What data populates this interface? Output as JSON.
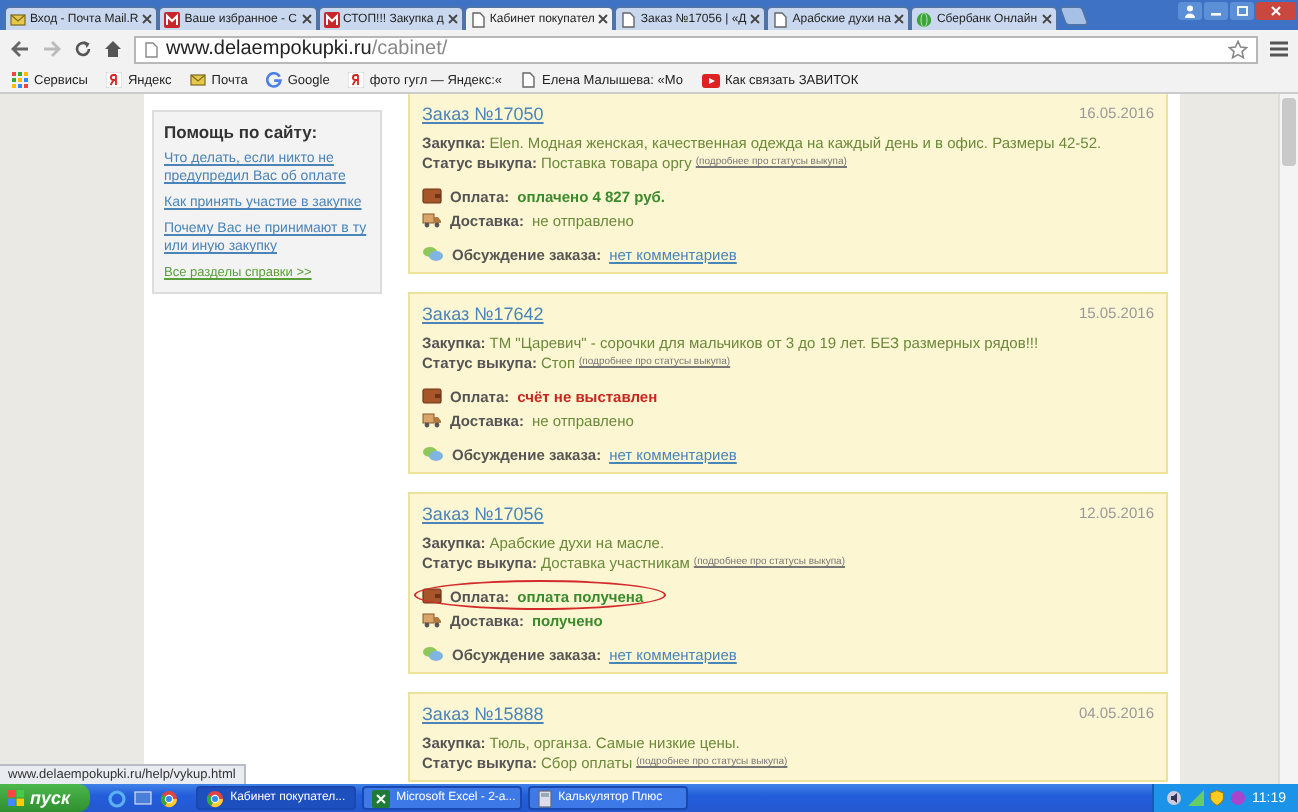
{
  "browser": {
    "tabs": [
      {
        "label": "Вход - Почта Mail.R",
        "selected": false
      },
      {
        "label": "Ваше избранное - С",
        "selected": false
      },
      {
        "label": "СТОП!!! Закупка д",
        "selected": false
      },
      {
        "label": "Кабинет покупател",
        "selected": true
      },
      {
        "label": "Заказ №17056 | «Д",
        "selected": false
      },
      {
        "label": "Арабские духи на",
        "selected": false
      },
      {
        "label": "Сбербанк Онлайн",
        "selected": false
      }
    ],
    "address": {
      "host": "www.delaempokupki.ru",
      "path": "/cabinet/"
    },
    "bookmarks": [
      {
        "label": "Сервисы"
      },
      {
        "label": "Яндекс"
      },
      {
        "label": "Почта"
      },
      {
        "label": "Google"
      },
      {
        "label": "фото гугл — Яндекс:«"
      },
      {
        "label": "Елена Малышева: «Мо"
      },
      {
        "label": "Как связать ЗАВИТОК"
      }
    ],
    "status_url": "www.delaempokupki.ru/help/vykup.html"
  },
  "sidebar": {
    "title": "Помощь по сайту:",
    "links": [
      {
        "label": "Что делать, если никто не предупредил Вас об оплате",
        "kind": "help"
      },
      {
        "label": "Как принять участие в закупке",
        "kind": "help"
      },
      {
        "label": "Почему Вас не принимают в ту или иную закупку",
        "kind": "help"
      },
      {
        "label": "Все разделы справки >>",
        "kind": "all"
      }
    ]
  },
  "orders": [
    {
      "title": "Заказ №17050",
      "date": "16.05.2016",
      "purchase_label": "Закупка:",
      "purchase": "Elen. Модная женская, качественная одежда на каждый день и в офис. Размеры 42-52.",
      "status_label": "Статус выкупа:",
      "status": "Поставка товара оргу",
      "status_link": "(подробнее про статусы выкупа)",
      "payment_label": "Оплата:",
      "payment": "оплачено 4 827 руб.",
      "paid": true,
      "circled": false,
      "delivery_label": "Доставка:",
      "delivery": "не отправлено",
      "delivered": false,
      "discussion_label": "Обсуждение заказа:",
      "discussion": "нет комментариев"
    },
    {
      "title": "Заказ №17642",
      "date": "15.05.2016",
      "purchase_label": "Закупка:",
      "purchase": "ТМ \"Царевич\" - сорочки для мальчиков от 3 до 19 лет. БЕЗ размерных рядов!!!",
      "status_label": "Статус выкупа:",
      "status": "Стоп",
      "status_link": "(подробнее про статусы выкупа)",
      "payment_label": "Оплата:",
      "payment": "счёт не выставлен",
      "paid": false,
      "circled": false,
      "delivery_label": "Доставка:",
      "delivery": "не отправлено",
      "delivered": false,
      "discussion_label": "Обсуждение заказа:",
      "discussion": "нет комментариев"
    },
    {
      "title": "Заказ №17056",
      "date": "12.05.2016",
      "purchase_label": "Закупка:",
      "purchase": "Арабские духи на масле.",
      "status_label": "Статус выкупа:",
      "status": "Доставка участникам",
      "status_link": "(подробнее про статусы выкупа)",
      "payment_label": "Оплата:",
      "payment": "оплата получена",
      "paid": true,
      "circled": true,
      "delivery_label": "Доставка:",
      "delivery": "получено",
      "delivered": true,
      "discussion_label": "Обсуждение заказа:",
      "discussion": "нет комментариев"
    },
    {
      "title": "Заказ №15888",
      "date": "04.05.2016",
      "purchase_label": "Закупка:",
      "purchase": "Тюль, органза. Самые низкие цены.",
      "status_label": "Статус выкупа:",
      "status": "Сбор оплаты",
      "status_link": "(подробнее про статусы выкупа)"
    }
  ],
  "taskbar": {
    "start": "пуск",
    "windows": [
      {
        "label": "Кабинет покупател...",
        "selected": true
      },
      {
        "label": "Microsoft Excel - 2-а...",
        "selected": false
      },
      {
        "label": "Калькулятор Плюс",
        "selected": false
      }
    ],
    "clock": "11:19"
  }
}
